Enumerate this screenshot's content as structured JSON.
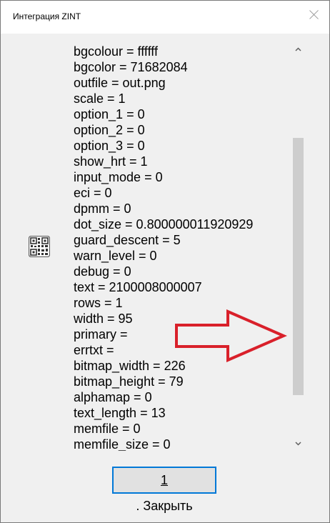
{
  "window": {
    "title": "Интеграция ZINT"
  },
  "list": {
    "items": [
      "bgcolour = ffffff",
      "bgcolor = 71682084",
      "outfile = out.png",
      "scale = 1",
      "option_1 = 0",
      "option_2 = 0",
      "option_3 = 0",
      "show_hrt = 1",
      "input_mode = 0",
      "eci = 0",
      "dpmm = 0",
      "dot_size = 0.800000011920929",
      "guard_descent = 5",
      "warn_level = 0",
      "debug = 0",
      "text = 2100008000007",
      "rows = 1",
      "width = 95",
      "primary =",
      "errtxt =",
      "bitmap_width = 226",
      "bitmap_height = 79",
      "alphamap = 0",
      "text_length = 13",
      "memfile = 0",
      "memfile_size = 0"
    ]
  },
  "footer": {
    "close_hotkey": "1",
    "close_rest": ". Закрыть"
  },
  "icons": {
    "qr": "qr-code-icon",
    "arrow": "red-arrow-annotation"
  },
  "colors": {
    "arrow_outline": "#d9202a",
    "focus_border": "#0078d7"
  }
}
